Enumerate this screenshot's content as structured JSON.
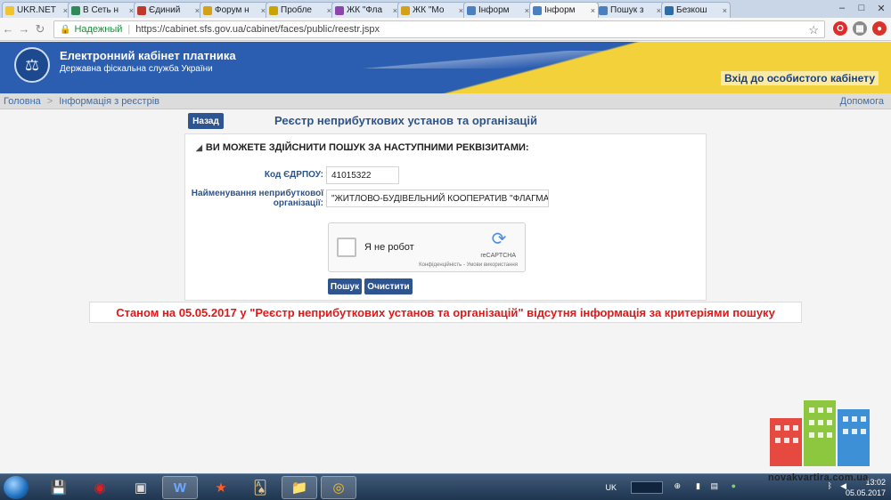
{
  "tabs": [
    {
      "label": "UKR.NET",
      "color": "#f0c330"
    },
    {
      "label": "В Сеть н",
      "color": "#2e8b57"
    },
    {
      "label": "Єдиний",
      "color": "#c0392b"
    },
    {
      "label": "Форум н",
      "color": "#d4a017"
    },
    {
      "label": "Пробле",
      "color": "#c9a400"
    },
    {
      "label": "ЖК \"Фла",
      "color": "#8e44ad"
    },
    {
      "label": "ЖК \"Мо",
      "color": "#d4a017"
    },
    {
      "label": "Інформ",
      "color": "#4a7fc1"
    },
    {
      "label": "Інформ",
      "color": "#4a7fc1",
      "active": true
    },
    {
      "label": "Пошук з",
      "color": "#4a7fc1"
    },
    {
      "label": "Безкош",
      "color": "#2e6da4"
    }
  ],
  "browser": {
    "secure_label": "Надежный",
    "url": "https://cabinet.sfs.gov.ua/cabinet/faces/public/reestr.jspx"
  },
  "header": {
    "title": "Електронний кабінет платника",
    "subtitle": "Державна фіскальна служба України",
    "login_link": "Вхід до особистого кабінету"
  },
  "breadcrumb": {
    "home": "Головна",
    "current": "Інформація з реєстрів",
    "help": "Допомога"
  },
  "page": {
    "back_button": "Назад",
    "heading": "Реєстр неприбуткових установ та організацій",
    "section_title": "ВИ МОЖЕТЕ ЗДІЙСНИТИ ПОШУК ЗА НАСТУПНИМИ РЕКВІЗИТАМИ:",
    "edrpou_label": "Код ЄДРПОУ:",
    "edrpou_value": "41015322",
    "name_label_line1": "Найменування неприбуткової",
    "name_label_line2": "організації:",
    "name_value": "\"ЖИТЛОВО-БУДІВЕЛЬНИЙ КООПЕРАТИВ \"ФЛАГМАНСЬК",
    "captcha_label": "Я не робот",
    "captcha_brand": "reCAPTCHA",
    "captcha_terms": "Конфіденційність - Умови використання",
    "search_button": "Пошук",
    "clear_button": "Очистити",
    "result_message": "Станом на 05.05.2017 у \"Реєстр неприбуткових установ та організацій\" відсутня інформація за критеріями пошуку"
  },
  "watermark": {
    "text": "novakvartira.com.ua"
  },
  "taskbar": {
    "lang": "UK",
    "time": "13:02",
    "date": "05.05.2017"
  }
}
